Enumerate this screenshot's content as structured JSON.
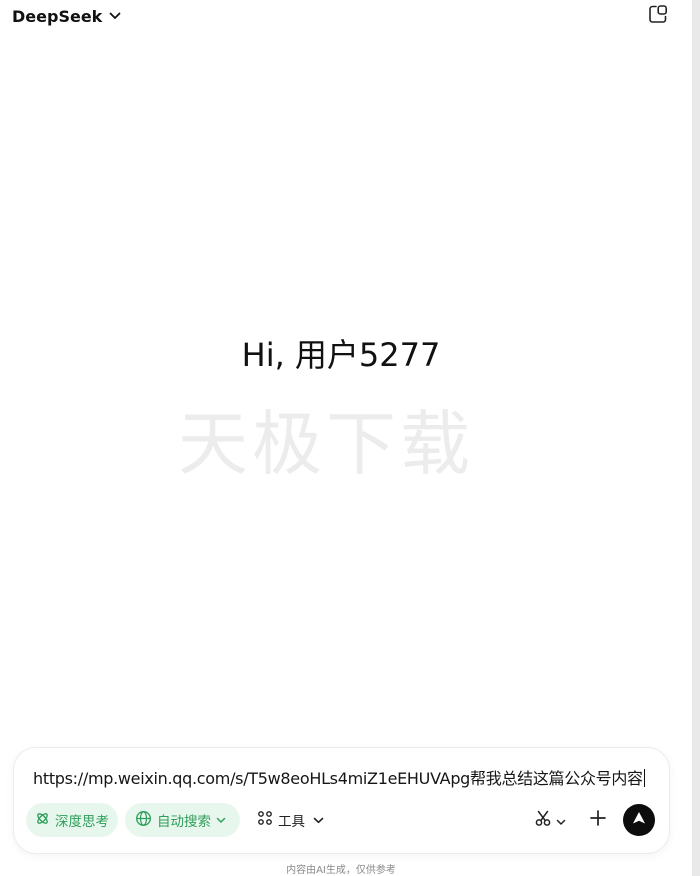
{
  "header": {
    "model_name": "DeepSeek",
    "model_chevron_icon": "chevron-down-icon",
    "new_chat_icon": "new-chat-icon"
  },
  "main": {
    "greeting": "Hi, 用户5277",
    "watermark": "天极下载"
  },
  "composer": {
    "input_value": "https://mp.weixin.qq.com/s/T5w8eoHLs4miZ1eEHUVApg帮我总结这篇公众号内容",
    "chips": {
      "deep_think": "深度思考",
      "auto_search": "自动搜索",
      "tools": "工具"
    },
    "accent_color": "#2f9e5b",
    "accent_bg": "#e8f7ee",
    "send_button_color": "#0d0d0d"
  },
  "footer": {
    "disclaimer": "内容由AI生成，仅供参考"
  }
}
